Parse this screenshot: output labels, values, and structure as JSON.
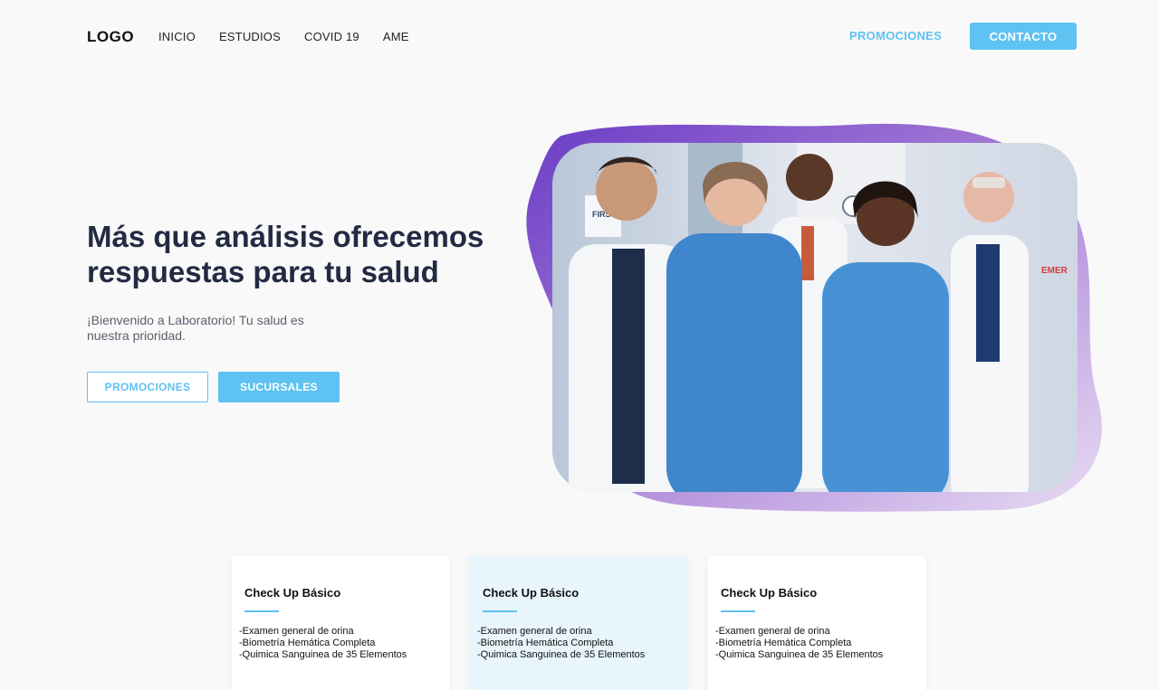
{
  "nav": {
    "logo": "LOGO",
    "links": [
      "INICIO",
      "ESTUDIOS",
      "COVID 19",
      "AME"
    ],
    "promo_link": "PROMOCIONES",
    "contact_button": "CONTACTO"
  },
  "hero": {
    "title": "Más que análisis ofrecemos respuestas para tu salud",
    "subtitle": "¡Bienvenido a Laboratorio! Tu salud es nuestra prioridad.",
    "promo_button": "PROMOCIONES",
    "branches_button": "SUCURSALES",
    "image_sign_text": "FIRST STATI",
    "image_exit_text": "EMER"
  },
  "cards": [
    {
      "title": "Check Up Básico",
      "items": [
        "-Examen general de orina",
        "-Biometría Hemática Completa",
        "-Quimica Sanguinea de 35 Elementos"
      ]
    },
    {
      "title": "Check Up Básico",
      "items": [
        "-Examen general de orina",
        "-Biometría Hemática Completa",
        "-Quimica Sanguinea de 35 Elementos"
      ]
    },
    {
      "title": "Check Up Básico",
      "items": [
        "-Examen general de orina",
        "-Biometría Hemática Completa",
        "-Quimica Sanguinea de 35 Elementos"
      ]
    }
  ],
  "colors": {
    "accent": "#5ec2f2",
    "heading": "#232b43",
    "blob_purple": "#7b3fc4",
    "blob_lavender": "#d9c6ea"
  }
}
